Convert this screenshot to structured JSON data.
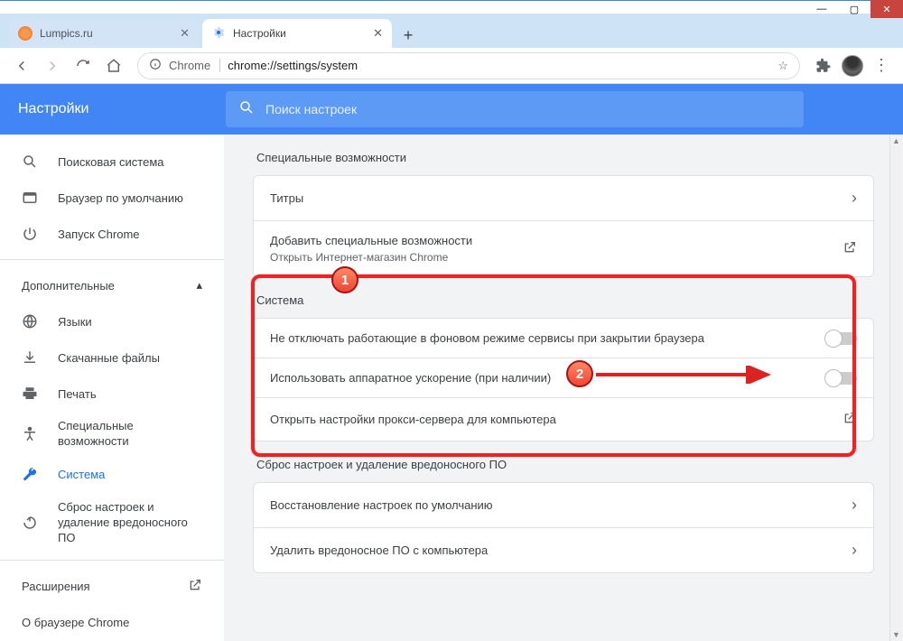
{
  "tabs": [
    {
      "title": "Lumpics.ru",
      "active": false
    },
    {
      "title": "Настройки",
      "active": true
    }
  ],
  "toolbar": {
    "chrome_label": "Chrome",
    "url": "chrome://settings/system"
  },
  "header": {
    "title": "Настройки"
  },
  "search": {
    "placeholder": "Поиск настроек"
  },
  "sidebar": {
    "items": [
      "Поисковая система",
      "Браузер по умолчанию",
      "Запуск Chrome"
    ],
    "advanced_label": "Дополнительные",
    "adv_items": [
      "Языки",
      "Скачанные файлы",
      "Печать",
      "Специальные возможности",
      "Система",
      "Сброс настроек и удаление вредоносного ПО"
    ],
    "extensions": "Расширения",
    "about": "О браузере Chrome"
  },
  "content": {
    "accessibility": {
      "title": "Специальные возможности",
      "row1": "Титры",
      "row2_title": "Добавить специальные возможности",
      "row2_sub": "Открыть Интернет-магазин Chrome"
    },
    "system": {
      "title": "Система",
      "row1": "Не отключать работающие в фоновом режиме сервисы при закрытии браузера",
      "row2": "Использовать аппаратное ускорение (при наличии)",
      "row3": "Открыть настройки прокси-сервера для компьютера"
    },
    "reset": {
      "title": "Сброс настроек и удаление вредоносного ПО",
      "row1": "Восстановление настроек по умолчанию",
      "row2": "Удалить вредоносное ПО с компьютера"
    }
  },
  "annotations": {
    "badge1": "1",
    "badge2": "2"
  }
}
